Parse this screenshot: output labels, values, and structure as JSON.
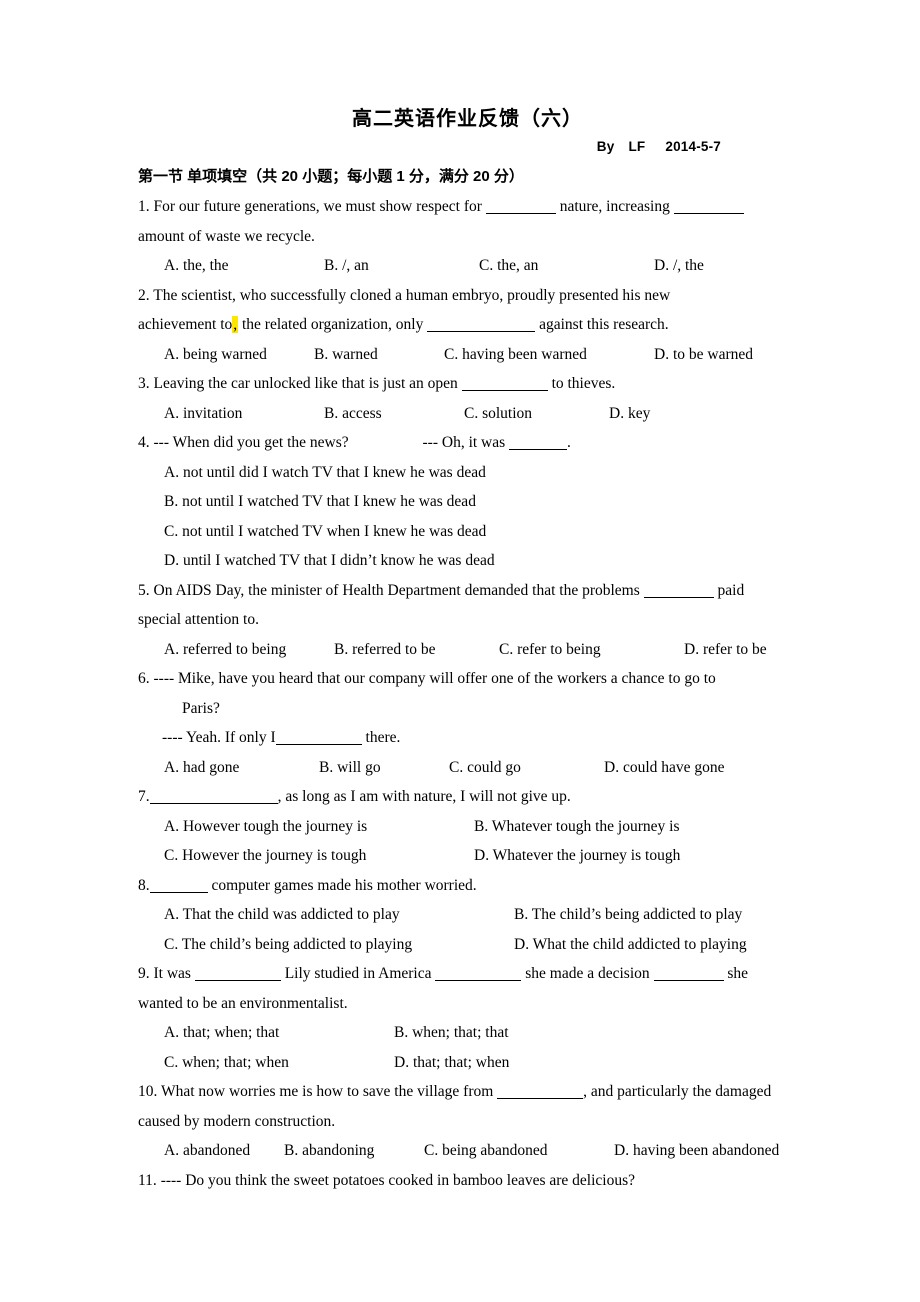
{
  "document": {
    "title": "高二英语作业反馈（六）",
    "byline": {
      "by": "By",
      "author": "LF",
      "date": "2014-5-7"
    },
    "section_heading": "第一节 单项填空（共 20 小题；每小题 1 分，满分 20 分）"
  },
  "questions": [
    {
      "number": "1.",
      "stem_part1": "For  our  future  generations,  we  must  show  respect  for",
      "stem_part2": "nature,  increasing",
      "stem_line2": "amount of waste we recycle.",
      "options": [
        "A. the, the",
        "B. /, an",
        "C. the, an",
        "D. /, the"
      ]
    },
    {
      "number": "2.",
      "stem_part1": "The  scientist,  who  successfully  cloned  a  human  embryo,  proudly  presented  his  new",
      "stem_line2_a": "achievement to",
      "stem_line2_comma": ",",
      "stem_line2_b": "the related organization, only",
      "stem_line2_c": "against this research.",
      "options": [
        "A. being warned",
        "B. warned",
        "C. having been warned",
        "D. to be warned"
      ]
    },
    {
      "number": "3.",
      "stem_part1": "Leaving the car unlocked like that is just an open",
      "stem_part2": "to thieves.",
      "options": [
        "A. invitation",
        "B. access",
        "C. solution",
        "D. key"
      ]
    },
    {
      "number": "4.",
      "stem_part1": "--- When did you get the news?",
      "stem_part2": "--- Oh, it was",
      "stem_part3": ".",
      "options": [
        "A. not until did I watch TV that I knew he was dead",
        "B. not until I watched TV that I knew he was dead",
        "C. not until I watched TV when I knew he was dead",
        "D. until I watched TV that I didn’t know he was dead"
      ]
    },
    {
      "number": "5.",
      "stem_part1": "On AIDS Day, the minister of Health Department demanded that the problems",
      "stem_part2": "paid",
      "stem_line2": "special attention to.",
      "options": [
        "A. referred to being",
        "B. referred to be",
        "C. refer to being",
        "D. refer to be"
      ]
    },
    {
      "number": "6.",
      "stem_part1": "----  Mike,  have  you  heard  that  our  company  will  offer  one  of  the  workers  a  chance  to  go  to",
      "stem_line2": "Paris?",
      "stem_line3_a": "---- Yeah. If only I",
      "stem_line3_b": "there.",
      "options": [
        "A. had gone",
        "B. will go",
        "C. could go",
        "D. could have gone"
      ]
    },
    {
      "number": "7.",
      "stem_part2": ", as long as I am with nature, I will not give up.",
      "options": [
        "A. However tough the journey is",
        "B. Whatever tough the journey is",
        "C. However the journey is tough",
        "D. Whatever the journey is tough"
      ]
    },
    {
      "number": "8.",
      "stem_part2": "computer games made his mother worried.",
      "options": [
        "A. That the child was addicted to play",
        "B. The child’s being addicted to play",
        "C. The child’s being addicted to playing",
        "D. What the child addicted to playing"
      ]
    },
    {
      "number": "9.",
      "stem_part1": "It  was",
      "stem_part2": "Lily  studied  in  America",
      "stem_part3": "she  made  a  decision",
      "stem_part4": "she",
      "stem_line2": "wanted to be an environmentalist.",
      "options": [
        "A. that; when; that",
        "B. when; that; that",
        "C. when; that; when",
        "D. that; that; when"
      ]
    },
    {
      "number": "10.",
      "stem_part1": "What now worries me is how to save the village from",
      "stem_part2": ", and particularly the damaged",
      "stem_line2": "caused by modern construction.",
      "options": [
        "A. abandoned",
        "B. abandoning",
        "C. being abandoned",
        "D. having been abandoned"
      ]
    },
    {
      "number": "11.",
      "stem_part1": "---- Do you think the sweet potatoes cooked in bamboo leaves are delicious?"
    }
  ]
}
